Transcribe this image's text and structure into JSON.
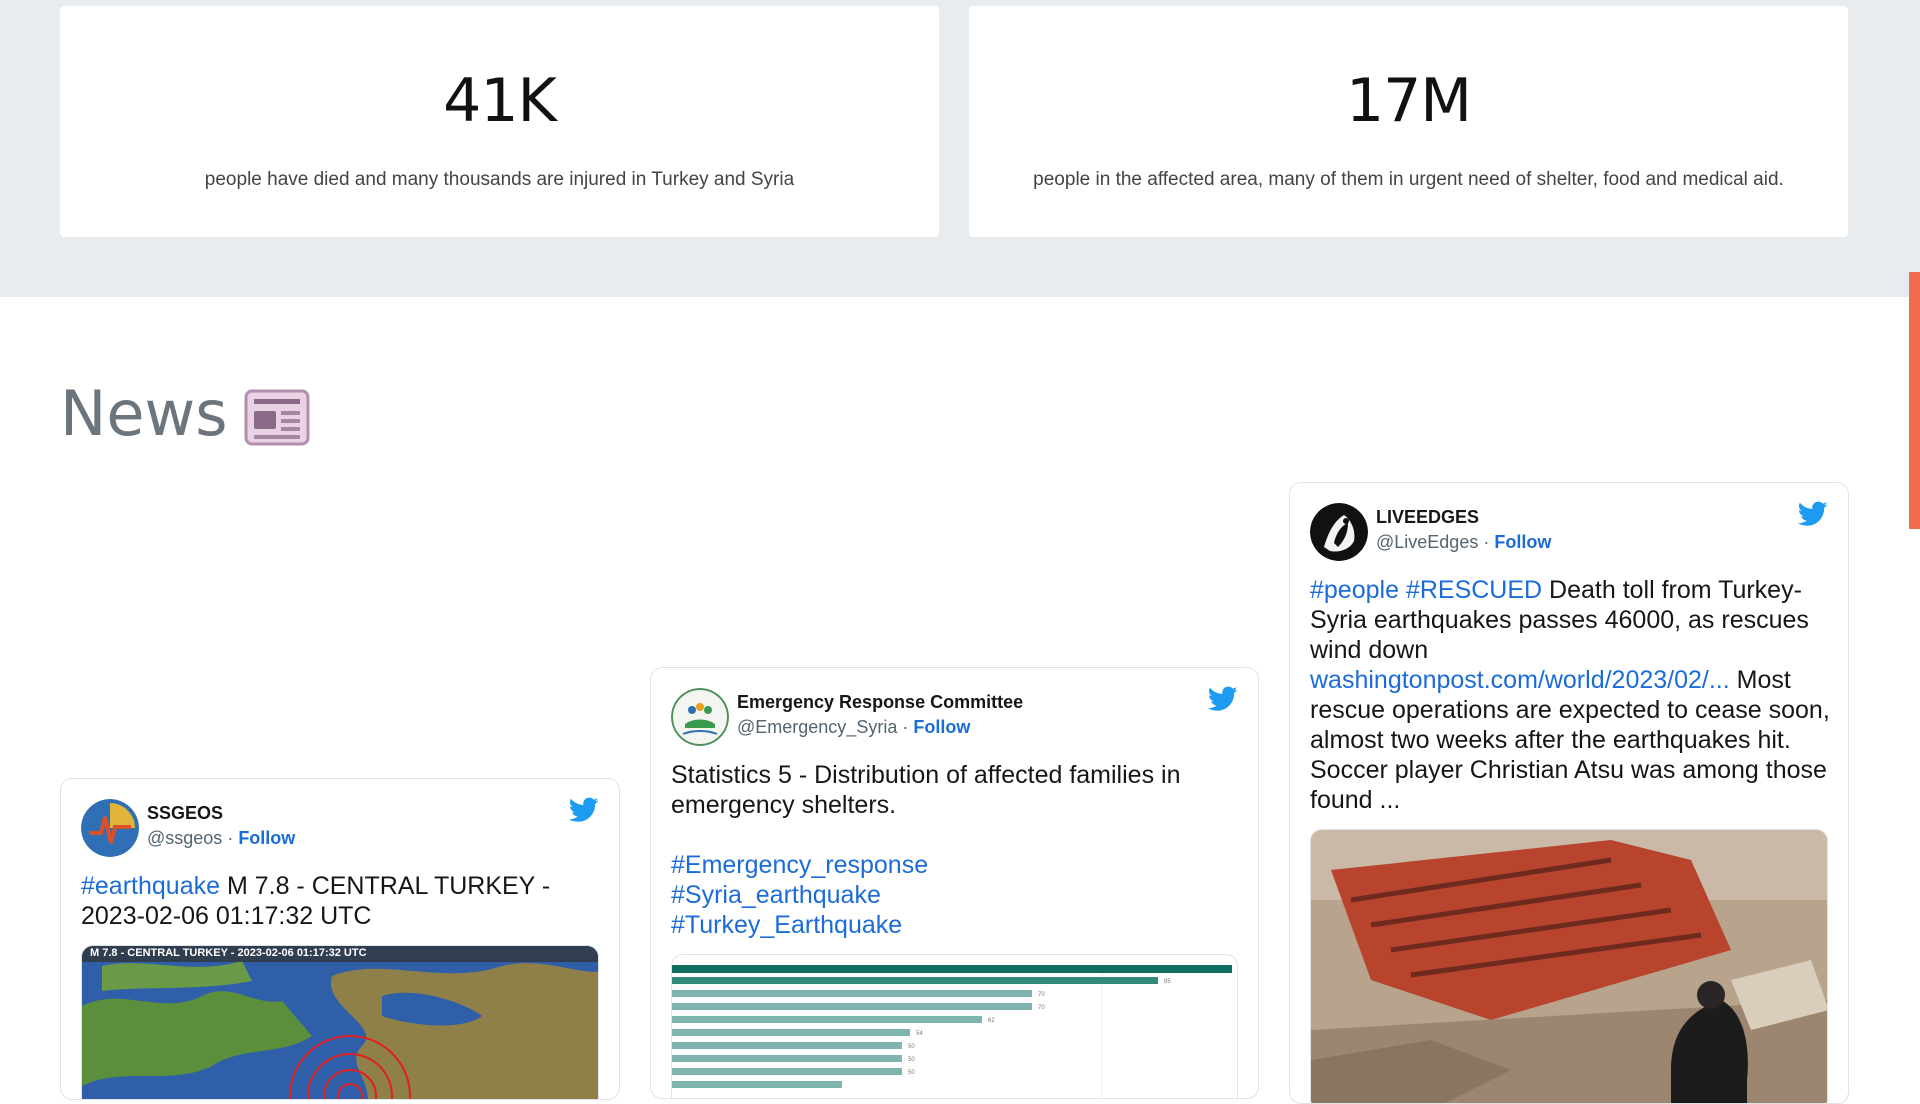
{
  "stats": [
    {
      "value": "41K",
      "description": "people have died and many thousands are injured in Turkey and Syria"
    },
    {
      "value": "17M",
      "description": "people in the affected area, many of them in urgent need of shelter, food and medical aid."
    }
  ],
  "news": {
    "heading": "News",
    "icon": "newspaper-icon"
  },
  "tweets": [
    {
      "name": "SSGEOS",
      "handle": "@ssgeos",
      "separator": " · ",
      "follow": "Follow",
      "tag1": "#earthquake",
      "text": " M 7.8 - CENTRAL TURKEY - 2023-02-06 01:17:32 UTC",
      "media_caption": "M 7.8 - CENTRAL TURKEY - 2023-02-06 01:17:32 UTC"
    },
    {
      "name": "Emergency Response Committee",
      "handle": "@Emergency_Syria",
      "separator": " · ",
      "follow": "Follow",
      "text": "Statistics 5 - Distribution of affected families in emergency shelters.",
      "tags": [
        "#Emergency_response",
        "#Syria_earthquake",
        "#Turkey_Earthquake"
      ],
      "chart_values": [
        "85",
        "70",
        "70",
        "62",
        "54",
        "50",
        "50",
        "50"
      ]
    },
    {
      "name": "LIVEEDGES",
      "handle": "@LiveEdges",
      "separator": " · ",
      "follow": "Follow",
      "tag1": "#people",
      "tag2": "#RESCUED",
      "text1": " Death toll from Turkey-Syria earthquakes passes 46000, as rescues wind down ",
      "link": "washingtonpost.com/world/2023/02/...",
      "text2": " Most rescue operations are expected to cease soon, almost two weeks after the earthquakes hit. Soccer player Christian Atsu was among those found ..."
    }
  ],
  "colors": {
    "band": "#e9ecee",
    "link": "#1b6cd8",
    "twitter": "#1d9bf0",
    "scrollbar": "#f26b4f",
    "bar_dark": "#0e6e5f",
    "bar_light": "#7fb5ae"
  }
}
